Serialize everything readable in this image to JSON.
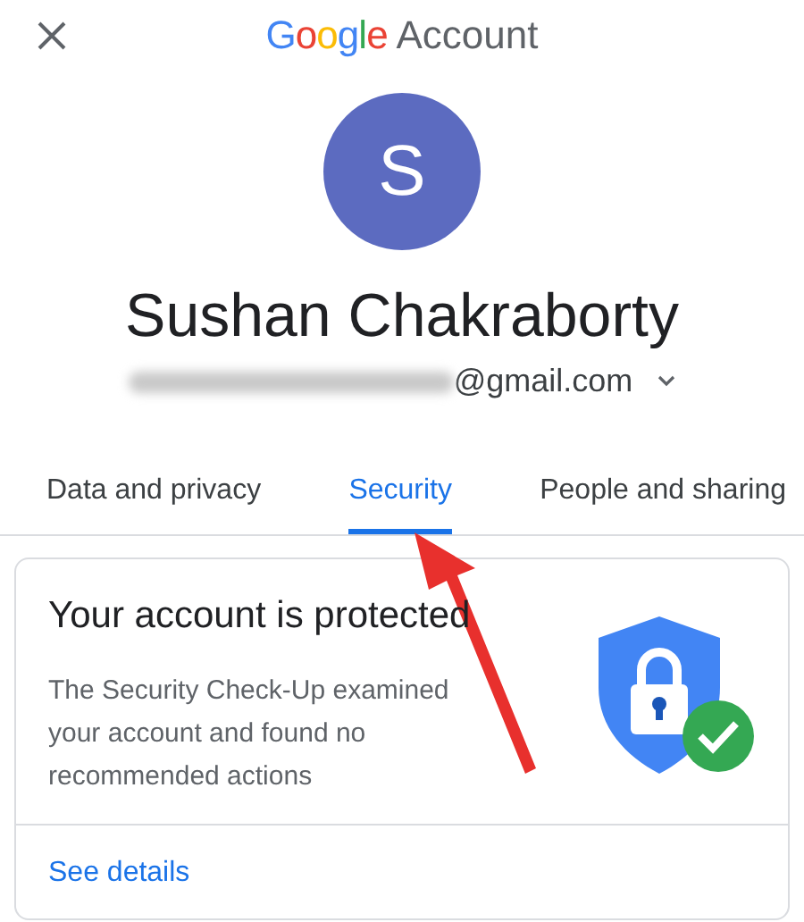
{
  "header": {
    "brand": "Google",
    "title": "Account"
  },
  "profile": {
    "initial": "S",
    "name": "Sushan Chakraborty",
    "email_visible": "@gmail.com",
    "email_redacted": true
  },
  "tabs": [
    {
      "label": "Data and privacy",
      "selected": false
    },
    {
      "label": "Security",
      "selected": true
    },
    {
      "label": "People and sharing",
      "selected": false
    }
  ],
  "card": {
    "title": "Your account is protected",
    "body": "The Security Check-Up examined your account and found no recommended actions",
    "link": "See details"
  }
}
